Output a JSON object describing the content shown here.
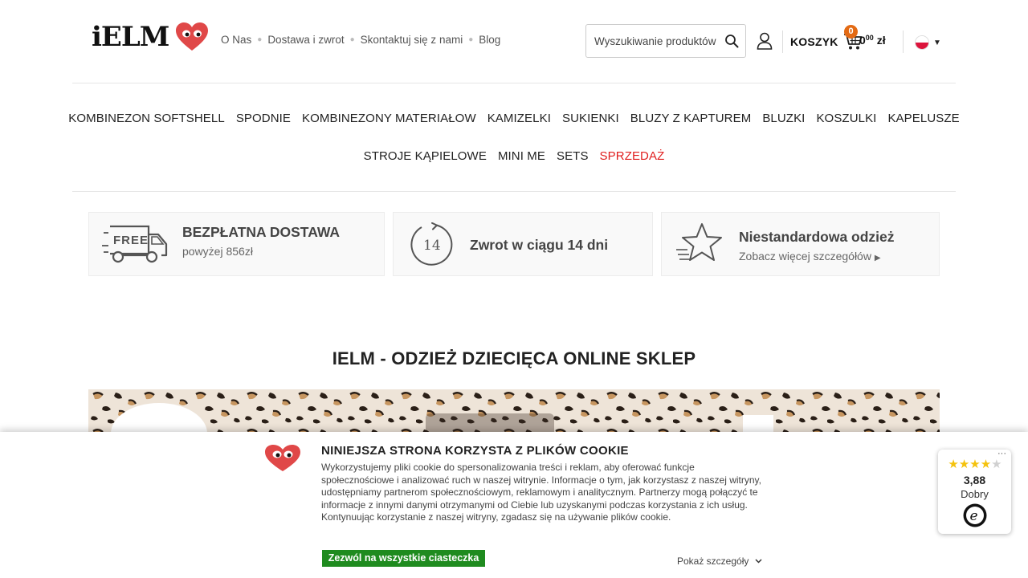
{
  "header": {
    "logo_text": "iELM",
    "top_links": [
      "O Nas",
      "Dostawa i zwrot",
      "Skontaktuj się z nami",
      "Blog"
    ],
    "search_placeholder": "Wyszukiwanie produktów",
    "cart_label": "KOSZYK",
    "cart_count": "0",
    "cart_total_main": "0",
    "cart_total_cents": "00",
    "cart_currency": "zł",
    "language": "pl"
  },
  "nav": {
    "row1": [
      "KOMBINEZON SOFTSHELL",
      "SPODNIE",
      "KOMBINEZONY MATERIAŁOW",
      "KAMIZELKI",
      "SUKIENKI",
      "BLUZY Z KAPTUREM",
      "BLUZKI",
      "KOSZULKI",
      "KAPELUSZE"
    ],
    "row2": [
      "STROJE KĄPIELOWE",
      "MINI ME",
      "SETS"
    ],
    "sale": "SPRZEDAŻ"
  },
  "features": [
    {
      "icon": "free-delivery-truck-icon",
      "icon_text": "FREE",
      "title": "BEZPŁATNA DOSTAWA",
      "subtitle": "powyżej 856zł"
    },
    {
      "icon": "return-14-days-icon",
      "icon_text": "14",
      "title": "Zwrot w ciągu 14 dni",
      "subtitle": ""
    },
    {
      "icon": "star-icon",
      "title": "Niestandardowa odzież",
      "subtitle": "Zobacz więcej szczegółów"
    }
  ],
  "main": {
    "title": "IELM - ODZIEŻ DZIECIĘCA ONLINE SKLEP"
  },
  "cookie": {
    "title": "NINIEJSZA STRONA KORZYSTA Z PLIKÓW COOKIE",
    "text": "Wykorzystujemy pliki cookie do spersonalizowania treści i reklam, aby oferować funkcje społecznościowe i analizować ruch w naszej witrynie. Informacje o tym, jak korzystasz z naszej witryny, udostępniamy partnerom społecznościowym, reklamowym i analitycznym. Partnerzy mogą połączyć te informacje z innymi danymi otrzymanymi od Ciebie lub uzyskanymi podczas korzystania z ich usług. Kontynuując korzystanie z naszej witryny, zgadasz się na używanie plików cookie.",
    "accept_button": "Zezwól na wszystkie ciasteczka",
    "details_link": "Pokaż szczegóły"
  },
  "trust_badge": {
    "rating": "3,88",
    "label": "Dobry",
    "stars_filled": 4,
    "stars_total": 5,
    "menu": "···"
  },
  "colors": {
    "accent": "#e36a14",
    "sale": "#e01e1e",
    "heart": "#e04848",
    "cookie_button": "#1f8b1f",
    "star": "#f4c20d"
  }
}
